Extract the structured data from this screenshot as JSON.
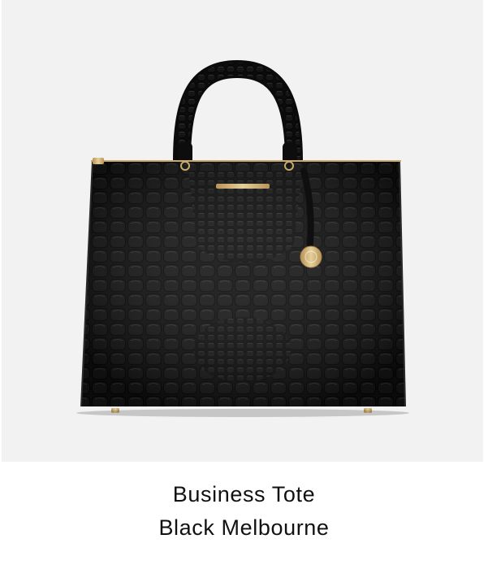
{
  "product": {
    "name": "Business Tote",
    "color_name": "Black Melbourne"
  },
  "image": {
    "icon": "handbag-product-photo",
    "background_color": "#f2f2f2",
    "bag_color": "#0d0d0d",
    "hardware_color": "#c9a96a"
  }
}
